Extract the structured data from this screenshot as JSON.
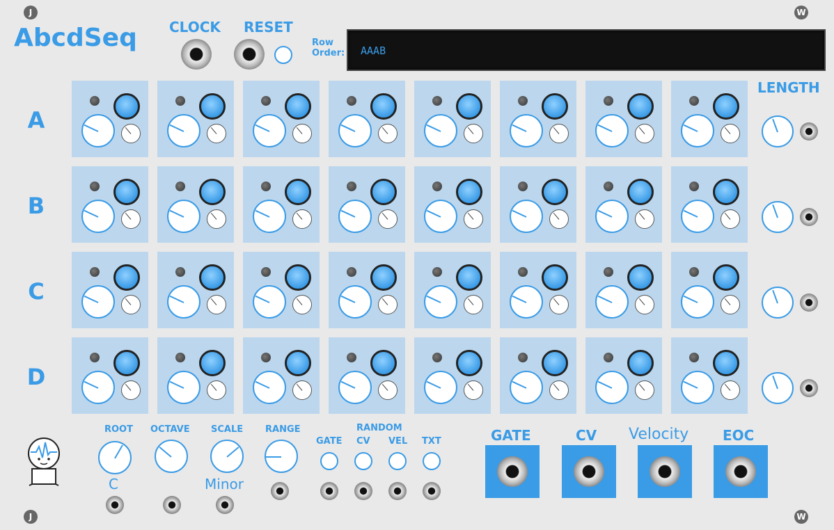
{
  "module": {
    "title": "AbcdSeq",
    "clock_label": "CLOCK",
    "reset_label": "RESET",
    "row_order_label_1": "Row",
    "row_order_label_2": "Order:",
    "row_order_value": "AAAB",
    "length_label": "LENGTH",
    "screw_left_top": "J",
    "screw_left_bottom": "J",
    "screw_right_top": "W",
    "screw_right_bottom": "W"
  },
  "rows": [
    {
      "label": "A"
    },
    {
      "label": "B"
    },
    {
      "label": "C"
    },
    {
      "label": "D"
    }
  ],
  "bottom": {
    "root_label": "ROOT",
    "root_value": "C",
    "octave_label": "OCTAVE",
    "scale_label": "SCALE",
    "scale_value": "Minor",
    "range_label": "RANGE",
    "random_label": "RANDOM",
    "gate_small": "GATE",
    "cv_small": "CV",
    "vel_small": "VEL",
    "txt_small": "TXT",
    "gate_out": "GATE",
    "cv_out": "CV",
    "velocity_out": "Velocity",
    "eoc_out": "EOC"
  },
  "colors": {
    "accent": "#3a9be6",
    "cell_bg": "#bcd7ed",
    "panel": "#e9e9e9",
    "display_bg": "#111111"
  }
}
